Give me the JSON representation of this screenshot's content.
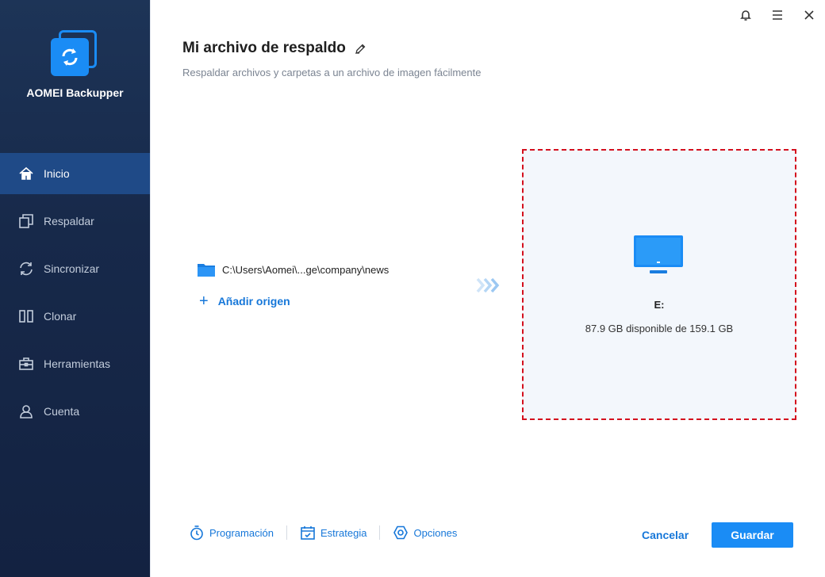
{
  "app": {
    "name": "AOMEI Backupper"
  },
  "sidebar": {
    "items": [
      {
        "label": "Inicio",
        "icon": "home-icon",
        "active": true
      },
      {
        "label": "Respaldar",
        "icon": "backup-icon",
        "active": false
      },
      {
        "label": "Sincronizar",
        "icon": "sync-icon",
        "active": false
      },
      {
        "label": "Clonar",
        "icon": "clone-icon",
        "active": false
      },
      {
        "label": "Herramientas",
        "icon": "toolbox-icon",
        "active": false
      },
      {
        "label": "Cuenta",
        "icon": "user-icon",
        "active": false
      }
    ]
  },
  "main": {
    "title": "Mi archivo de respaldo",
    "subtitle": "Respaldar archivos y carpetas a un archivo de imagen fácilmente",
    "source": {
      "path": "C:\\Users\\Aomei\\...ge\\company\\news",
      "icon": "folder-icon"
    },
    "add_source_label": "Añadir origen",
    "destination": {
      "drive": "E:",
      "space": "87.9 GB disponible de 159.1 GB",
      "icon": "monitor-icon"
    }
  },
  "footer": {
    "schedule_label": "Programación",
    "strategy_label": "Estrategia",
    "options_label": "Opciones",
    "cancel_label": "Cancelar",
    "save_label": "Guardar"
  },
  "colors": {
    "accent": "#1a8cf5",
    "sidebar_bg": "#17294a",
    "active_bg": "#1f4a87",
    "dashed_border": "#d4101e"
  }
}
